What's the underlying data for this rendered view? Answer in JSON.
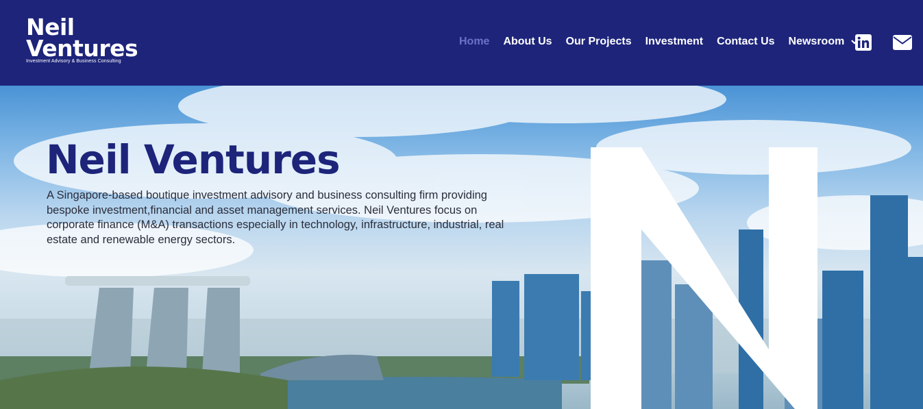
{
  "brand": {
    "line1": "Neil",
    "line2": "Ventures",
    "tagline": "Investment Advisory & Business Consulting"
  },
  "nav": {
    "items": [
      {
        "label": "Home",
        "active": true
      },
      {
        "label": "About Us"
      },
      {
        "label": "Our Projects"
      },
      {
        "label": "Investment"
      },
      {
        "label": "Contact Us"
      },
      {
        "label": "Newsroom",
        "has_dropdown": true
      }
    ],
    "social": [
      "linkedin-icon",
      "envelope-icon"
    ]
  },
  "hero": {
    "title": "Neil Ventures",
    "description": "A Singapore-based boutique investment advisory and business consulting firm providing bespoke investment,financial and asset management services. Neil Ventures focus on corporate finance (M&A) transactions especially in technology, infrastructure, industrial, real estate and renewable energy sectors."
  },
  "colors": {
    "header_bg": "#1d247a",
    "nav_active": "#6b73c8",
    "title": "#1d247a"
  }
}
